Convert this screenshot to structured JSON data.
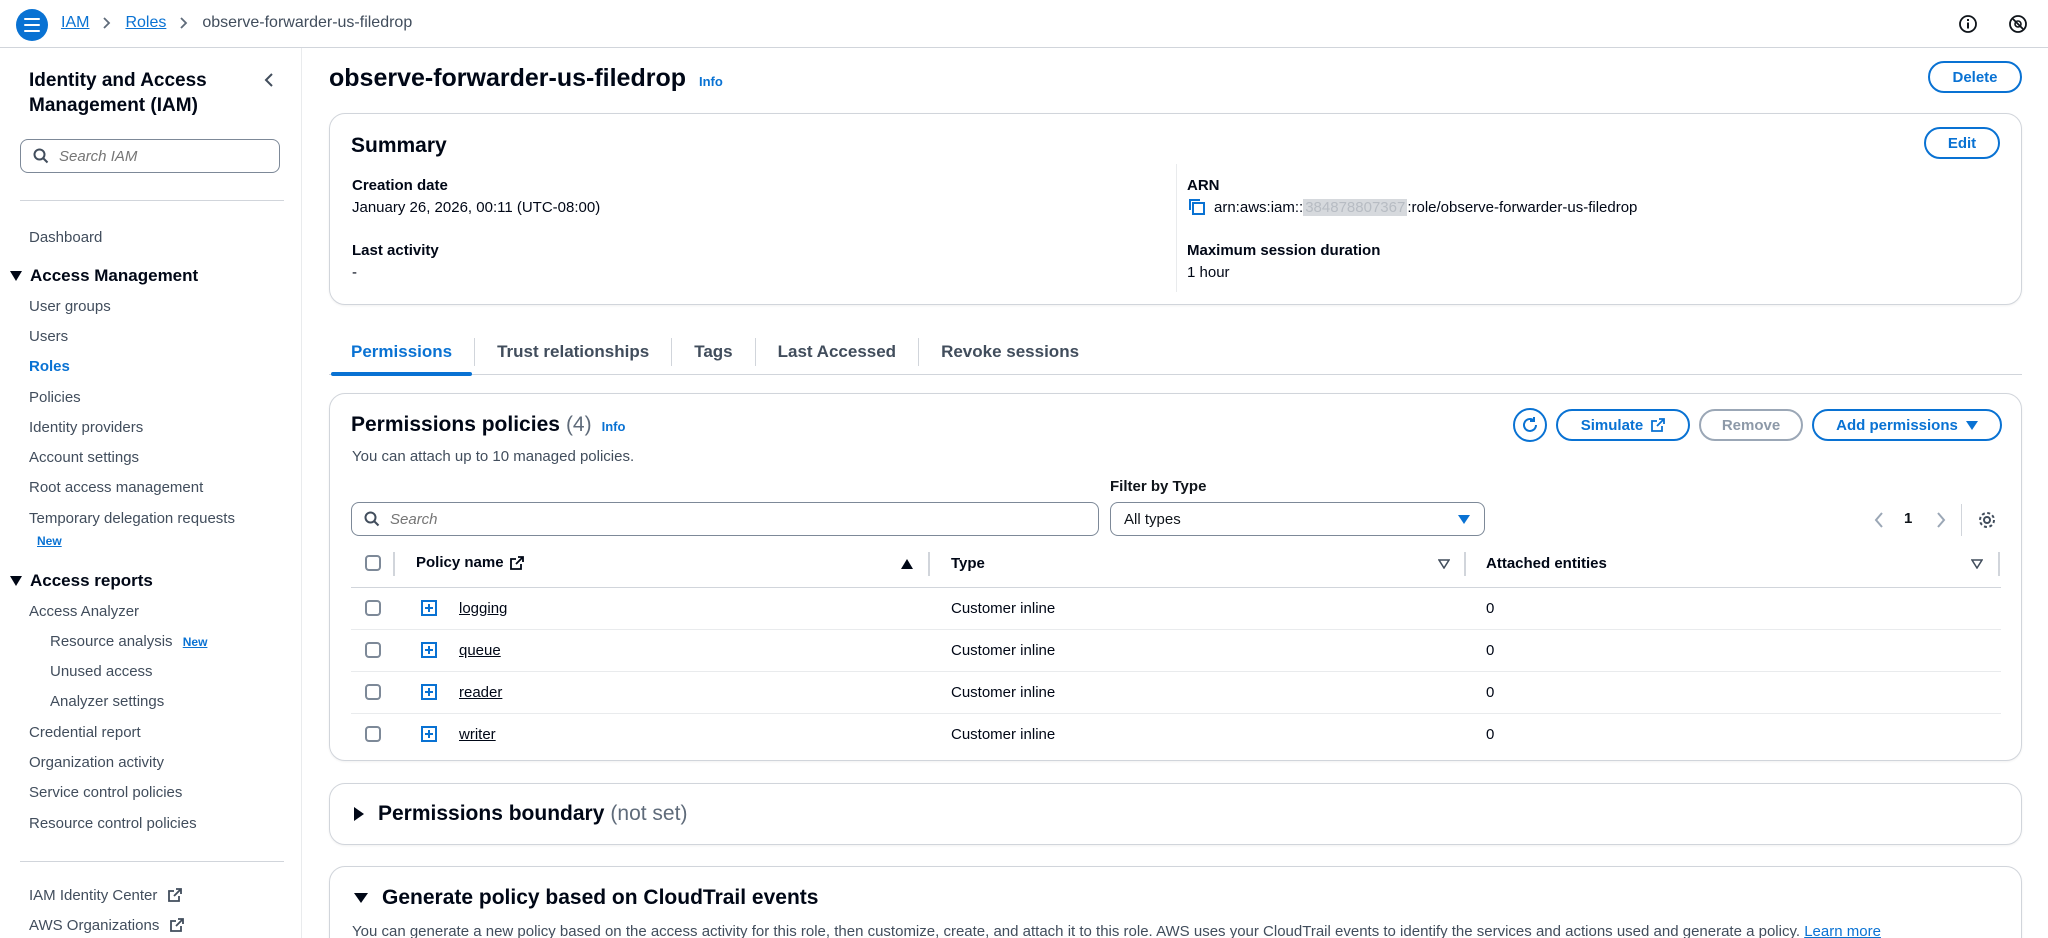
{
  "breadcrumb": {
    "items": [
      "IAM",
      "Roles"
    ],
    "current": "observe-forwarder-us-filedrop"
  },
  "sidebar": {
    "title": "Identity and Access Management (IAM)",
    "search_placeholder": "Search IAM",
    "dashboard": "Dashboard",
    "access_management": {
      "label": "Access Management",
      "items": [
        "User groups",
        "Users",
        "Roles",
        "Policies",
        "Identity providers",
        "Account settings",
        "Root access management",
        "Temporary delegation requests"
      ],
      "active": "Roles",
      "new_badge": "New"
    },
    "access_reports": {
      "label": "Access reports",
      "access_analyzer": "Access Analyzer",
      "sub_items": [
        "Resource analysis",
        "Unused access",
        "Analyzer settings"
      ],
      "new_badge": "New",
      "items": [
        "Credential report",
        "Organization activity",
        "Service control policies",
        "Resource control policies"
      ]
    },
    "external": [
      "IAM Identity Center",
      "AWS Organizations"
    ]
  },
  "page": {
    "title": "observe-forwarder-us-filedrop",
    "info": "Info",
    "delete_label": "Delete"
  },
  "summary": {
    "heading": "Summary",
    "edit_label": "Edit",
    "creation_date_label": "Creation date",
    "creation_date": "January 26, 2026, 00:11 (UTC-08:00)",
    "last_activity_label": "Last activity",
    "last_activity": "-",
    "arn_label": "ARN",
    "arn_prefix": "arn:aws:iam::",
    "arn_account": "384878807367",
    "arn_suffix": ":role/observe-forwarder-us-filedrop",
    "max_session_label": "Maximum session duration",
    "max_session": "1 hour"
  },
  "tabs": [
    "Permissions",
    "Trust relationships",
    "Tags",
    "Last Accessed",
    "Revoke sessions"
  ],
  "permissions": {
    "heading": "Permissions policies",
    "count": "(4)",
    "info": "Info",
    "description": "You can attach up to 10 managed policies.",
    "simulate_label": "Simulate",
    "remove_label": "Remove",
    "add_label": "Add permissions",
    "search_placeholder": "Search",
    "filter_label": "Filter by Type",
    "filter_value": "All types",
    "page_number": "1",
    "columns": [
      "Policy name",
      "Type",
      "Attached entities"
    ],
    "rows": [
      {
        "name": "logging",
        "type": "Customer inline",
        "entities": "0"
      },
      {
        "name": "queue",
        "type": "Customer inline",
        "entities": "0"
      },
      {
        "name": "reader",
        "type": "Customer inline",
        "entities": "0"
      },
      {
        "name": "writer",
        "type": "Customer inline",
        "entities": "0"
      }
    ]
  },
  "boundary": {
    "heading": "Permissions boundary",
    "status": "(not set)"
  },
  "cloudtrail": {
    "heading": "Generate policy based on CloudTrail events",
    "description": "You can generate a new policy based on the access activity for this role, then customize, create, and attach it to this role. AWS uses your CloudTrail events to identify the services and actions used and generate a policy.",
    "learn_more": "Learn more"
  }
}
